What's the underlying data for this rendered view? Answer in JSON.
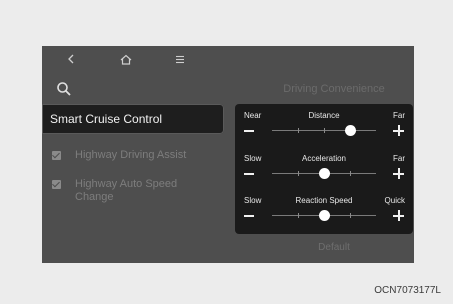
{
  "nav": {
    "back_icon": "chevron-left-icon",
    "home_icon": "home-icon",
    "menu_icon": "hamburger-menu-icon"
  },
  "search_icon": "search-icon",
  "title": "Driving Convenience",
  "sidebar": {
    "selected": "Smart Cruise Control",
    "options": [
      {
        "label": "Highway Driving Assist",
        "checked": true
      },
      {
        "label": "Highway Auto Speed Change",
        "checked": true
      }
    ]
  },
  "settings": {
    "distance": {
      "label": "Distance",
      "min_label": "Near",
      "max_label": "Far",
      "level": 3,
      "steps": 4
    },
    "acceleration": {
      "label": "Acceleration",
      "min_label": "Slow",
      "max_label": "Far",
      "level": 2,
      "steps": 4
    },
    "reaction": {
      "label": "Reaction Speed",
      "min_label": "Slow",
      "max_label": "Quick",
      "level": 2,
      "steps": 4
    }
  },
  "default_label": "Default",
  "caption": "OCN7073177L"
}
